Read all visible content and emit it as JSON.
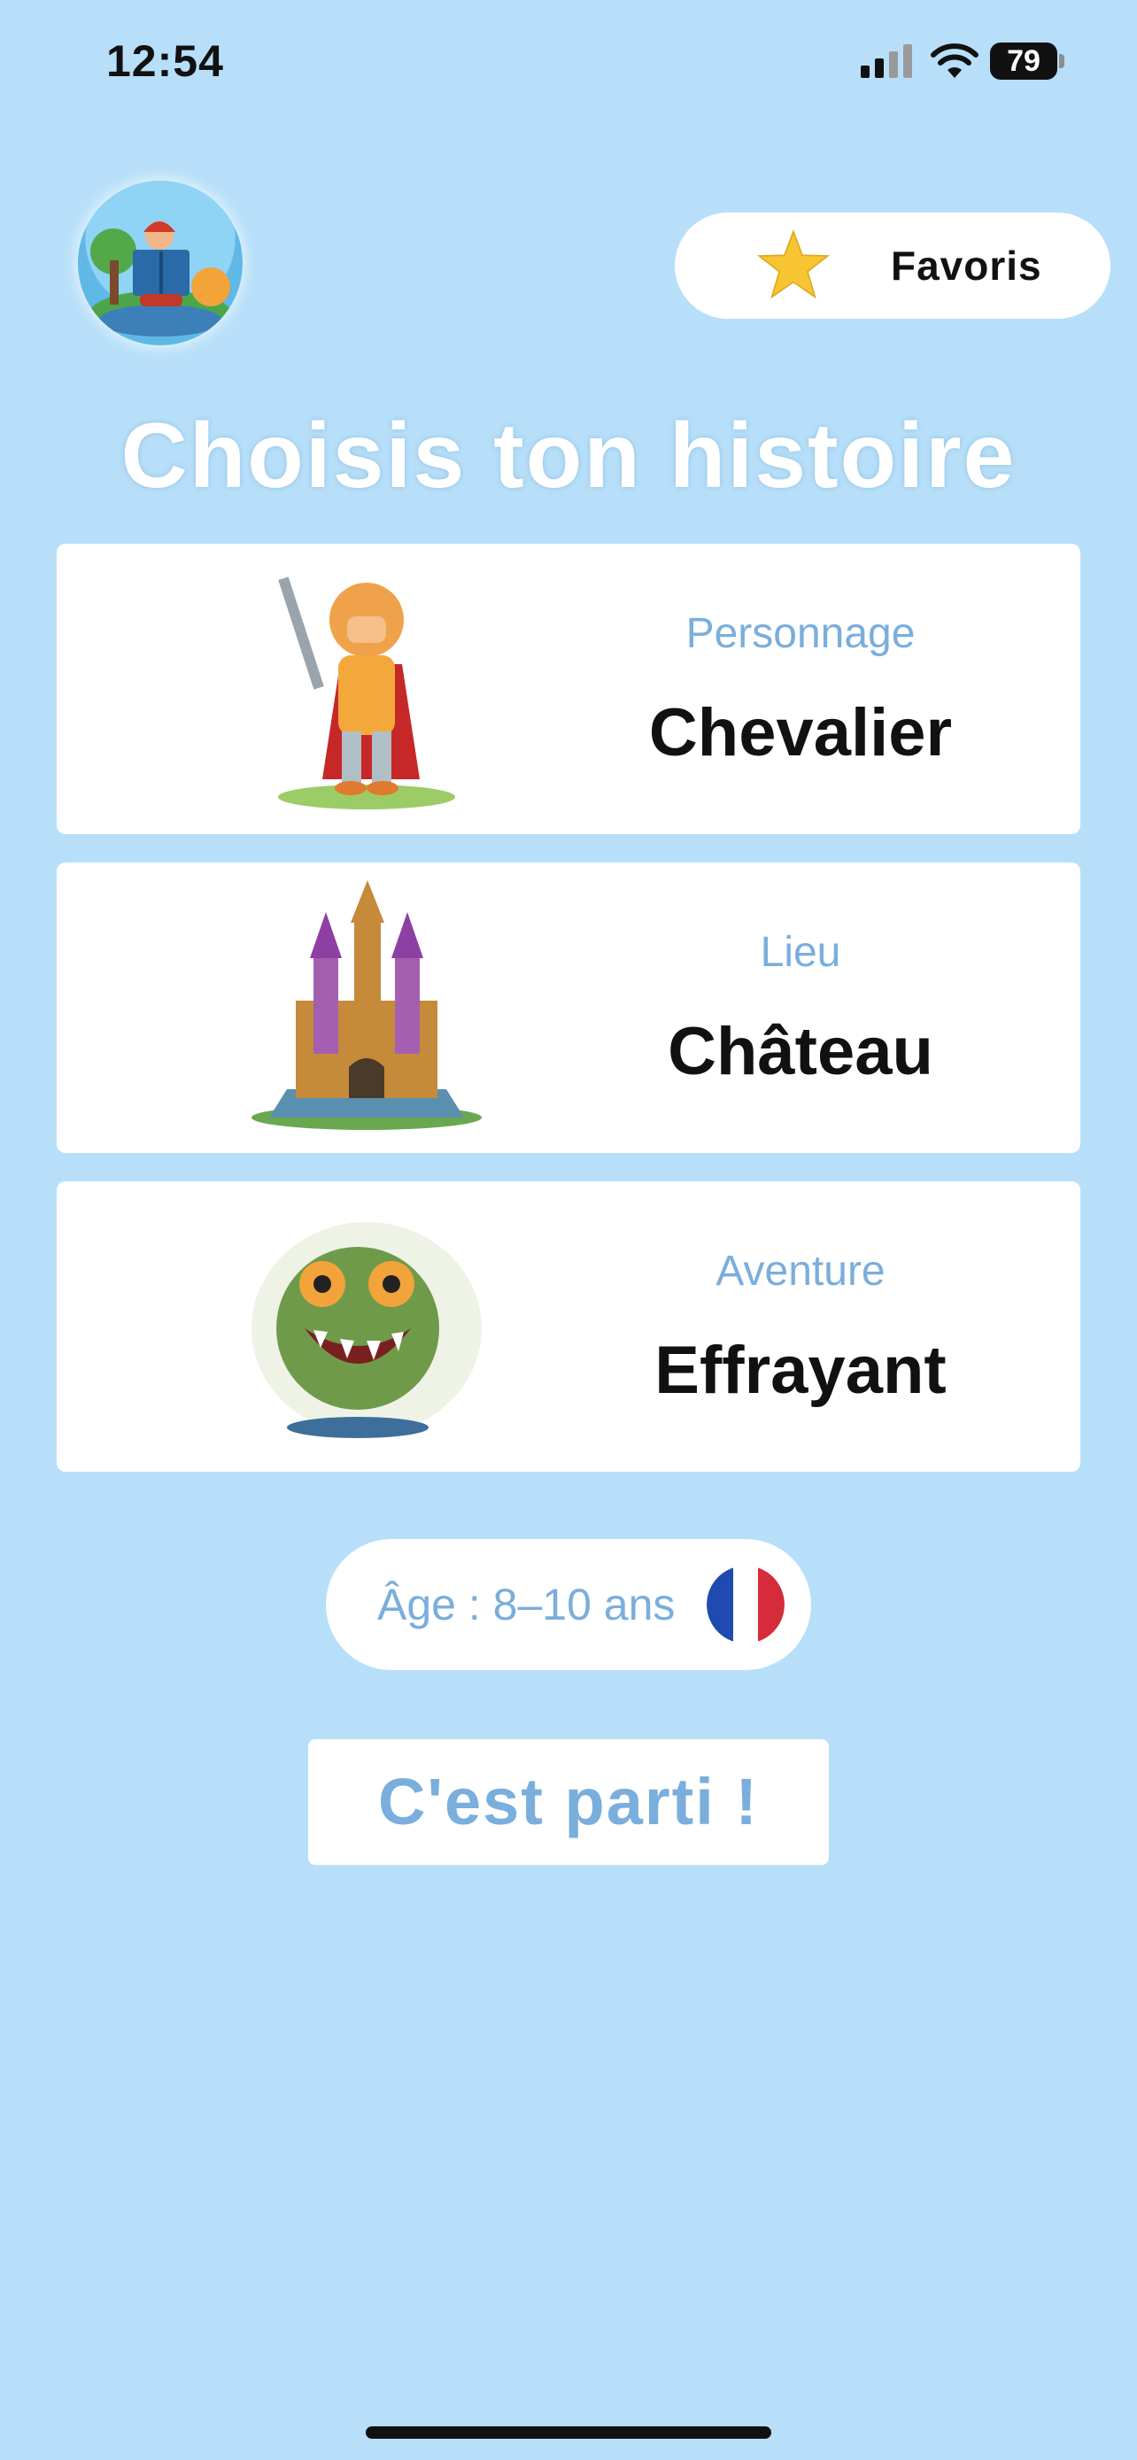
{
  "status_bar": {
    "time": "12:54",
    "battery": "79"
  },
  "header": {
    "favorites_label": "Favoris",
    "favorites_icon": "star-icon"
  },
  "title": "Choisis ton histoire",
  "cards": [
    {
      "category": "Personnage",
      "value": "Chevalier",
      "image": "knight-illustration"
    },
    {
      "category": "Lieu",
      "value": "Château",
      "image": "castle-illustration"
    },
    {
      "category": "Aventure",
      "value": "Effrayant",
      "image": "monster-illustration"
    }
  ],
  "age_selector": {
    "label": "Âge : 8–10 ans",
    "language_flag": "france-flag-icon"
  },
  "start_button": {
    "label": "C'est parti !"
  },
  "colors": {
    "background": "#b7dff9",
    "accent_text": "#7aaedc",
    "card": "#ffffff",
    "star": "#f7c531"
  }
}
